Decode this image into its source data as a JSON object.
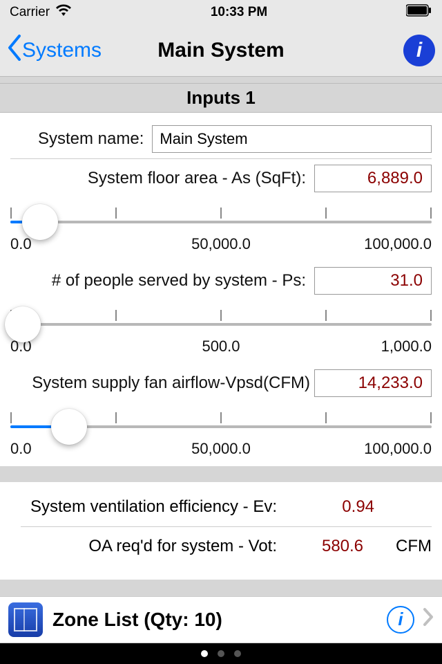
{
  "status": {
    "carrier": "Carrier",
    "time": "10:33 PM"
  },
  "nav": {
    "back": "Systems",
    "title": "Main System"
  },
  "section_header": "Inputs 1",
  "inputs": {
    "name_label": "System name:",
    "name_value": "Main System",
    "floor_area": {
      "label": "System floor area - As (SqFt):",
      "value": "6,889.0",
      "min": "0.0",
      "mid": "50,000.0",
      "max": "100,000.0",
      "pct": 7
    },
    "people": {
      "label": "# of people served by system - Ps:",
      "value": "31.0",
      "min": "0.0",
      "mid": "500.0",
      "max": "1,000.0",
      "pct": 3
    },
    "airflow": {
      "label": "System supply fan airflow-Vpsd(CFM)",
      "value": "14,233.0",
      "min": "0.0",
      "mid": "50,000.0",
      "max": "100,000.0",
      "pct": 14
    }
  },
  "outputs": {
    "ev_label": "System ventilation efficiency - Ev:",
    "ev_value": "0.94",
    "vot_label": "OA req'd for system - Vot:",
    "vot_value": "580.6",
    "vot_unit": "CFM"
  },
  "zone": {
    "label": "Zone List (Qty: 10)"
  },
  "pager": {
    "count": 3,
    "active": 0
  }
}
